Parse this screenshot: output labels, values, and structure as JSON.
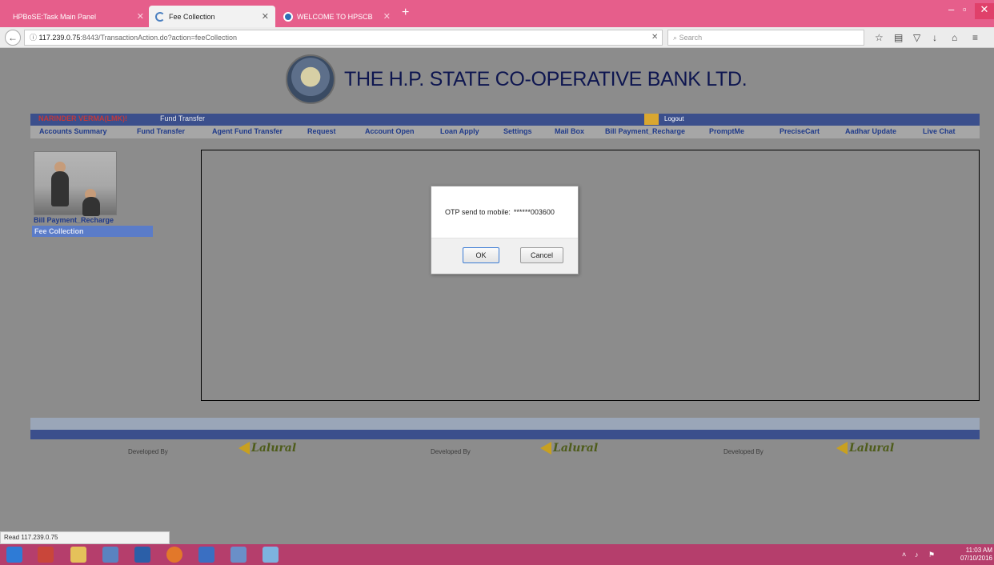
{
  "browser": {
    "tabs": [
      {
        "label": "HPBoSE:Task Main Panel"
      },
      {
        "label": "Fee Collection"
      },
      {
        "label": "WELCOME TO HPSCB"
      }
    ],
    "url_host": "117.239.0.75",
    "url_rest": ":8443/TransactionAction.do?action=feeCollection",
    "search_placeholder": "Search",
    "status": "Read 117.239.0.75"
  },
  "header": {
    "bank_title": "THE H.P. STATE CO-OPERATIVE BANK LTD.",
    "username": "NARINDER VERMA(LMK)!",
    "breadcrumb": "Fund Transfer",
    "logout": "Logout"
  },
  "menu": [
    "Accounts Summary",
    "Fund Transfer",
    "Agent Fund Transfer",
    "Request",
    "Account Open",
    "Loan Apply",
    "Settings",
    "Mail Box",
    "Bill Payment_Recharge",
    "PromptMe",
    "PreciseCart",
    "Aadhar Update",
    "Live Chat"
  ],
  "sidebar": {
    "category": "Bill Payment_Recharge",
    "selected_item": "Fee Collection"
  },
  "dialog": {
    "message": "OTP send to mobile:",
    "masked_number": "******003600",
    "ok_label": "OK",
    "cancel_label": "Cancel"
  },
  "footer": {
    "developed_by": "Developed By",
    "vendor": "Lalural"
  },
  "taskbar": {
    "time": "11:03 AM",
    "date": "07/10/2016"
  },
  "colors": {
    "titlebar": "#e65e8b",
    "taskbar": "#b53e6c",
    "bank_blue": "#3b4f8c",
    "menu_text": "#1f3a8a"
  }
}
